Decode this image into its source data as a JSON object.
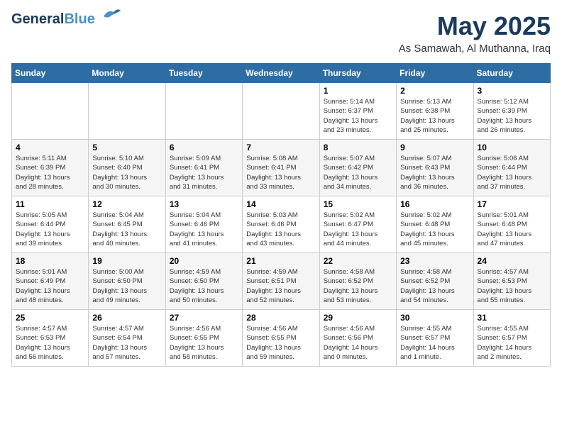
{
  "logo": {
    "line1": "General",
    "line2": "Blue"
  },
  "title": "May 2025",
  "subtitle": "As Samawah, Al Muthanna, Iraq",
  "weekdays": [
    "Sunday",
    "Monday",
    "Tuesday",
    "Wednesday",
    "Thursday",
    "Friday",
    "Saturday"
  ],
  "weeks": [
    [
      {
        "day": "",
        "info": ""
      },
      {
        "day": "",
        "info": ""
      },
      {
        "day": "",
        "info": ""
      },
      {
        "day": "",
        "info": ""
      },
      {
        "day": "1",
        "info": "Sunrise: 5:14 AM\nSunset: 6:37 PM\nDaylight: 13 hours\nand 23 minutes."
      },
      {
        "day": "2",
        "info": "Sunrise: 5:13 AM\nSunset: 6:38 PM\nDaylight: 13 hours\nand 25 minutes."
      },
      {
        "day": "3",
        "info": "Sunrise: 5:12 AM\nSunset: 6:39 PM\nDaylight: 13 hours\nand 26 minutes."
      }
    ],
    [
      {
        "day": "4",
        "info": "Sunrise: 5:11 AM\nSunset: 6:39 PM\nDaylight: 13 hours\nand 28 minutes."
      },
      {
        "day": "5",
        "info": "Sunrise: 5:10 AM\nSunset: 6:40 PM\nDaylight: 13 hours\nand 30 minutes."
      },
      {
        "day": "6",
        "info": "Sunrise: 5:09 AM\nSunset: 6:41 PM\nDaylight: 13 hours\nand 31 minutes."
      },
      {
        "day": "7",
        "info": "Sunrise: 5:08 AM\nSunset: 6:41 PM\nDaylight: 13 hours\nand 33 minutes."
      },
      {
        "day": "8",
        "info": "Sunrise: 5:07 AM\nSunset: 6:42 PM\nDaylight: 13 hours\nand 34 minutes."
      },
      {
        "day": "9",
        "info": "Sunrise: 5:07 AM\nSunset: 6:43 PM\nDaylight: 13 hours\nand 36 minutes."
      },
      {
        "day": "10",
        "info": "Sunrise: 5:06 AM\nSunset: 6:44 PM\nDaylight: 13 hours\nand 37 minutes."
      }
    ],
    [
      {
        "day": "11",
        "info": "Sunrise: 5:05 AM\nSunset: 6:44 PM\nDaylight: 13 hours\nand 39 minutes."
      },
      {
        "day": "12",
        "info": "Sunrise: 5:04 AM\nSunset: 6:45 PM\nDaylight: 13 hours\nand 40 minutes."
      },
      {
        "day": "13",
        "info": "Sunrise: 5:04 AM\nSunset: 6:46 PM\nDaylight: 13 hours\nand 41 minutes."
      },
      {
        "day": "14",
        "info": "Sunrise: 5:03 AM\nSunset: 6:46 PM\nDaylight: 13 hours\nand 43 minutes."
      },
      {
        "day": "15",
        "info": "Sunrise: 5:02 AM\nSunset: 6:47 PM\nDaylight: 13 hours\nand 44 minutes."
      },
      {
        "day": "16",
        "info": "Sunrise: 5:02 AM\nSunset: 6:48 PM\nDaylight: 13 hours\nand 45 minutes."
      },
      {
        "day": "17",
        "info": "Sunrise: 5:01 AM\nSunset: 6:48 PM\nDaylight: 13 hours\nand 47 minutes."
      }
    ],
    [
      {
        "day": "18",
        "info": "Sunrise: 5:01 AM\nSunset: 6:49 PM\nDaylight: 13 hours\nand 48 minutes."
      },
      {
        "day": "19",
        "info": "Sunrise: 5:00 AM\nSunset: 6:50 PM\nDaylight: 13 hours\nand 49 minutes."
      },
      {
        "day": "20",
        "info": "Sunrise: 4:59 AM\nSunset: 6:50 PM\nDaylight: 13 hours\nand 50 minutes."
      },
      {
        "day": "21",
        "info": "Sunrise: 4:59 AM\nSunset: 6:51 PM\nDaylight: 13 hours\nand 52 minutes."
      },
      {
        "day": "22",
        "info": "Sunrise: 4:58 AM\nSunset: 6:52 PM\nDaylight: 13 hours\nand 53 minutes."
      },
      {
        "day": "23",
        "info": "Sunrise: 4:58 AM\nSunset: 6:52 PM\nDaylight: 13 hours\nand 54 minutes."
      },
      {
        "day": "24",
        "info": "Sunrise: 4:57 AM\nSunset: 6:53 PM\nDaylight: 13 hours\nand 55 minutes."
      }
    ],
    [
      {
        "day": "25",
        "info": "Sunrise: 4:57 AM\nSunset: 6:53 PM\nDaylight: 13 hours\nand 56 minutes."
      },
      {
        "day": "26",
        "info": "Sunrise: 4:57 AM\nSunset: 6:54 PM\nDaylight: 13 hours\nand 57 minutes."
      },
      {
        "day": "27",
        "info": "Sunrise: 4:56 AM\nSunset: 6:55 PM\nDaylight: 13 hours\nand 58 minutes."
      },
      {
        "day": "28",
        "info": "Sunrise: 4:56 AM\nSunset: 6:55 PM\nDaylight: 13 hours\nand 59 minutes."
      },
      {
        "day": "29",
        "info": "Sunrise: 4:56 AM\nSunset: 6:56 PM\nDaylight: 14 hours\nand 0 minutes."
      },
      {
        "day": "30",
        "info": "Sunrise: 4:55 AM\nSunset: 6:57 PM\nDaylight: 14 hours\nand 1 minute."
      },
      {
        "day": "31",
        "info": "Sunrise: 4:55 AM\nSunset: 6:57 PM\nDaylight: 14 hours\nand 2 minutes."
      }
    ]
  ]
}
